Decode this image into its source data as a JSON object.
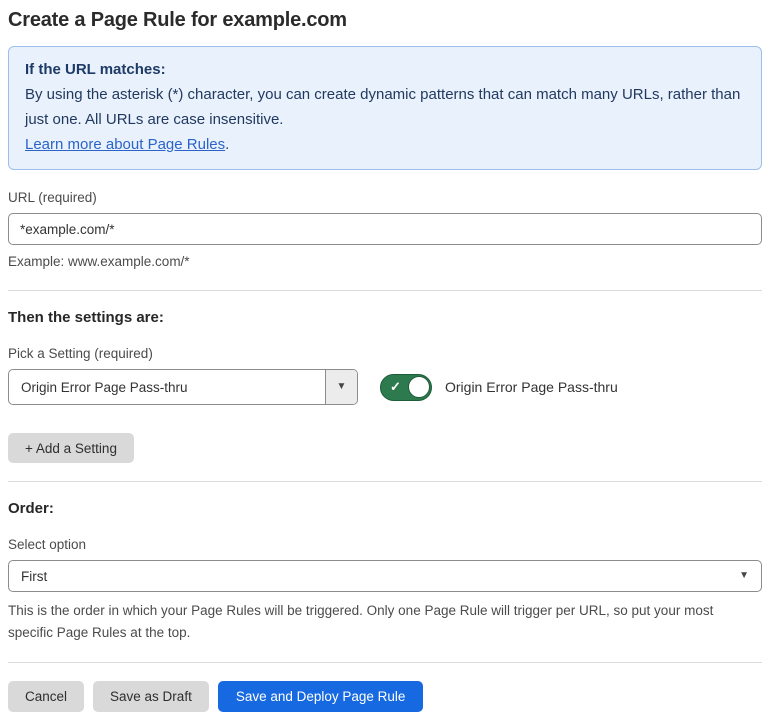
{
  "page": {
    "title": "Create a Page Rule for example.com"
  },
  "info_box": {
    "heading": "If the URL matches:",
    "body": "By using the asterisk (*) character, you can create dynamic patterns that can match many URLs, rather than just one. All URLs are case insensitive.",
    "link_label": "Learn more about Page Rules",
    "link_suffix": "."
  },
  "url_field": {
    "label": "URL (required)",
    "value": "*example.com/*",
    "helper": "Example: www.example.com/*"
  },
  "settings_section": {
    "heading": "Then the settings are:",
    "picker_label": "Pick a Setting (required)",
    "picker_value": "Origin Error Page Pass-thru",
    "dropdown_arrow": "▼",
    "toggle_state": "on",
    "toggle_check": "✓",
    "toggle_label": "Origin Error Page Pass-thru",
    "add_setting_label": "+ Add a Setting"
  },
  "order_section": {
    "heading": "Order:",
    "select_label": "Select option",
    "select_value": "First",
    "select_arrow": "▼",
    "helper": "This is the order in which your Page Rules will be triggered. Only one Page Rule will trigger per URL, so put your most specific Page Rules at the top."
  },
  "footer": {
    "cancel_label": "Cancel",
    "save_draft_label": "Save as Draft",
    "save_deploy_label": "Save and Deploy Page Rule"
  },
  "colors": {
    "info_bg": "#e9f2fc",
    "info_border": "#9cc0ea",
    "info_text": "#22395f",
    "link_blue": "#2b63c9",
    "primary_blue": "#1669e0",
    "toggle_green": "#2c7a4e",
    "button_gray": "#d9d9d9"
  }
}
